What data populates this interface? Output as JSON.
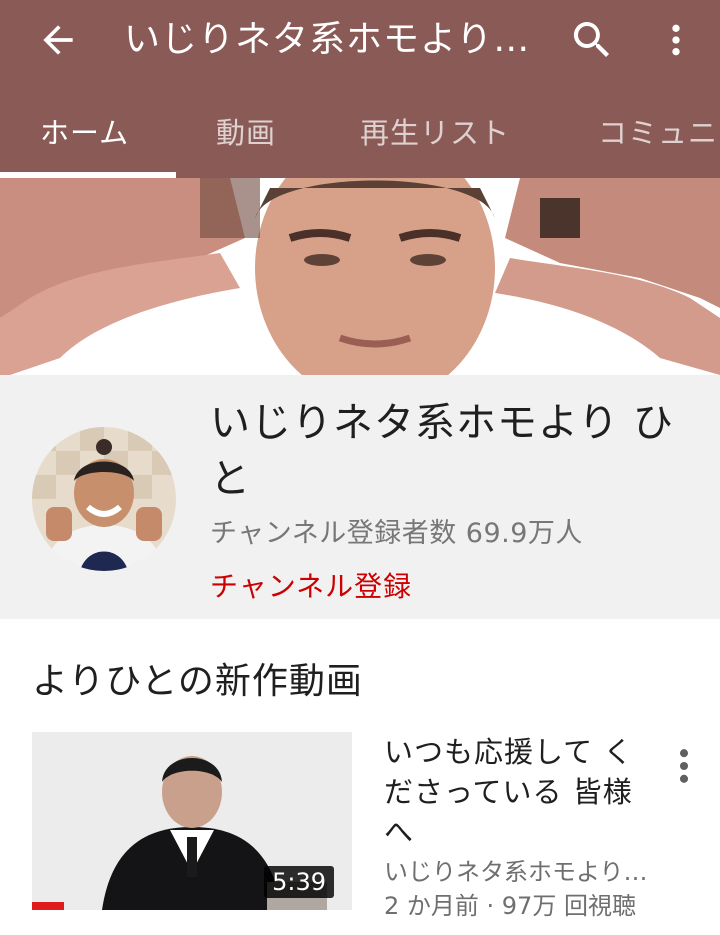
{
  "appbar": {
    "title": "いじりネタ系ホモより…",
    "icons": {
      "back": "arrow-left-icon",
      "search": "search-icon",
      "more": "more-vert-icon"
    },
    "color": "#8a5a56"
  },
  "tabs": [
    {
      "label": "ホーム",
      "active": true
    },
    {
      "label": "動画",
      "active": false
    },
    {
      "label": "再生リスト",
      "active": false
    },
    {
      "label": "コミュニ",
      "active": false
    }
  ],
  "channel": {
    "name": "いじりネタ系ホモより ひと",
    "subscribers": "チャンネル登録者数 69.9万人",
    "subscribe_label": "チャンネル登録"
  },
  "section": {
    "title": "よりひとの新作動画"
  },
  "video": {
    "title": "いつも応援して くださっている 皆様へ",
    "duration": "5:39",
    "channel": "いじりネタ系ホモより…",
    "meta": "2 か月前 · 97万 回視聴",
    "progress": 0.1
  }
}
